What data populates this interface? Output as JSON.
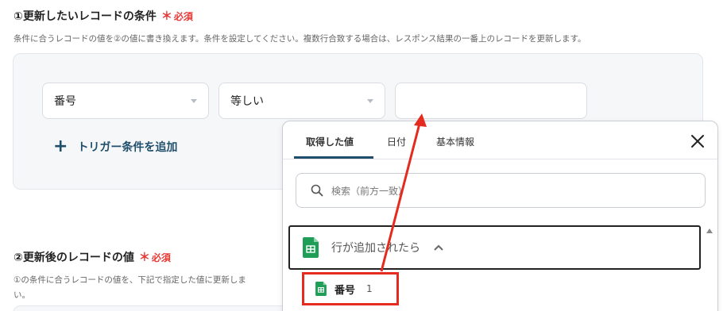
{
  "section1": {
    "title": "①更新したいレコードの条件",
    "required_mark": "＊",
    "required": "必須",
    "description": "条件に合うレコードの値を②の値に書き換えます。条件を設定してください。複数行合致する場合は、レスポンス結果の一番上のレコードを更新します。"
  },
  "condition": {
    "field": "番号",
    "operator": "等しい",
    "value": ""
  },
  "add_trigger_label": "トリガー条件を追加",
  "section2": {
    "title": "②更新後のレコードの値",
    "required_mark": "＊",
    "required": "必須",
    "description": "①の条件に合うレコードの値を、下記で指定した値に更新しま",
    "description_wrap": "い。"
  },
  "popover": {
    "tabs": [
      {
        "label": "取得した値",
        "active": true
      },
      {
        "label": "日付",
        "active": false
      },
      {
        "label": "基本情報",
        "active": false
      }
    ],
    "search_placeholder": "検索（前方一致）",
    "group": {
      "label": "行が追加されたら",
      "icon": "google-sheets-icon",
      "icon_char": "田"
    },
    "items": [
      {
        "label": "番号",
        "count": "1",
        "icon": "google-sheets-icon",
        "icon_char": "田"
      }
    ]
  },
  "colors": {
    "required": "#e53935",
    "accent": "#1f4e6b",
    "sheets_green": "#1e9e57",
    "highlight": "#e52b1f"
  }
}
